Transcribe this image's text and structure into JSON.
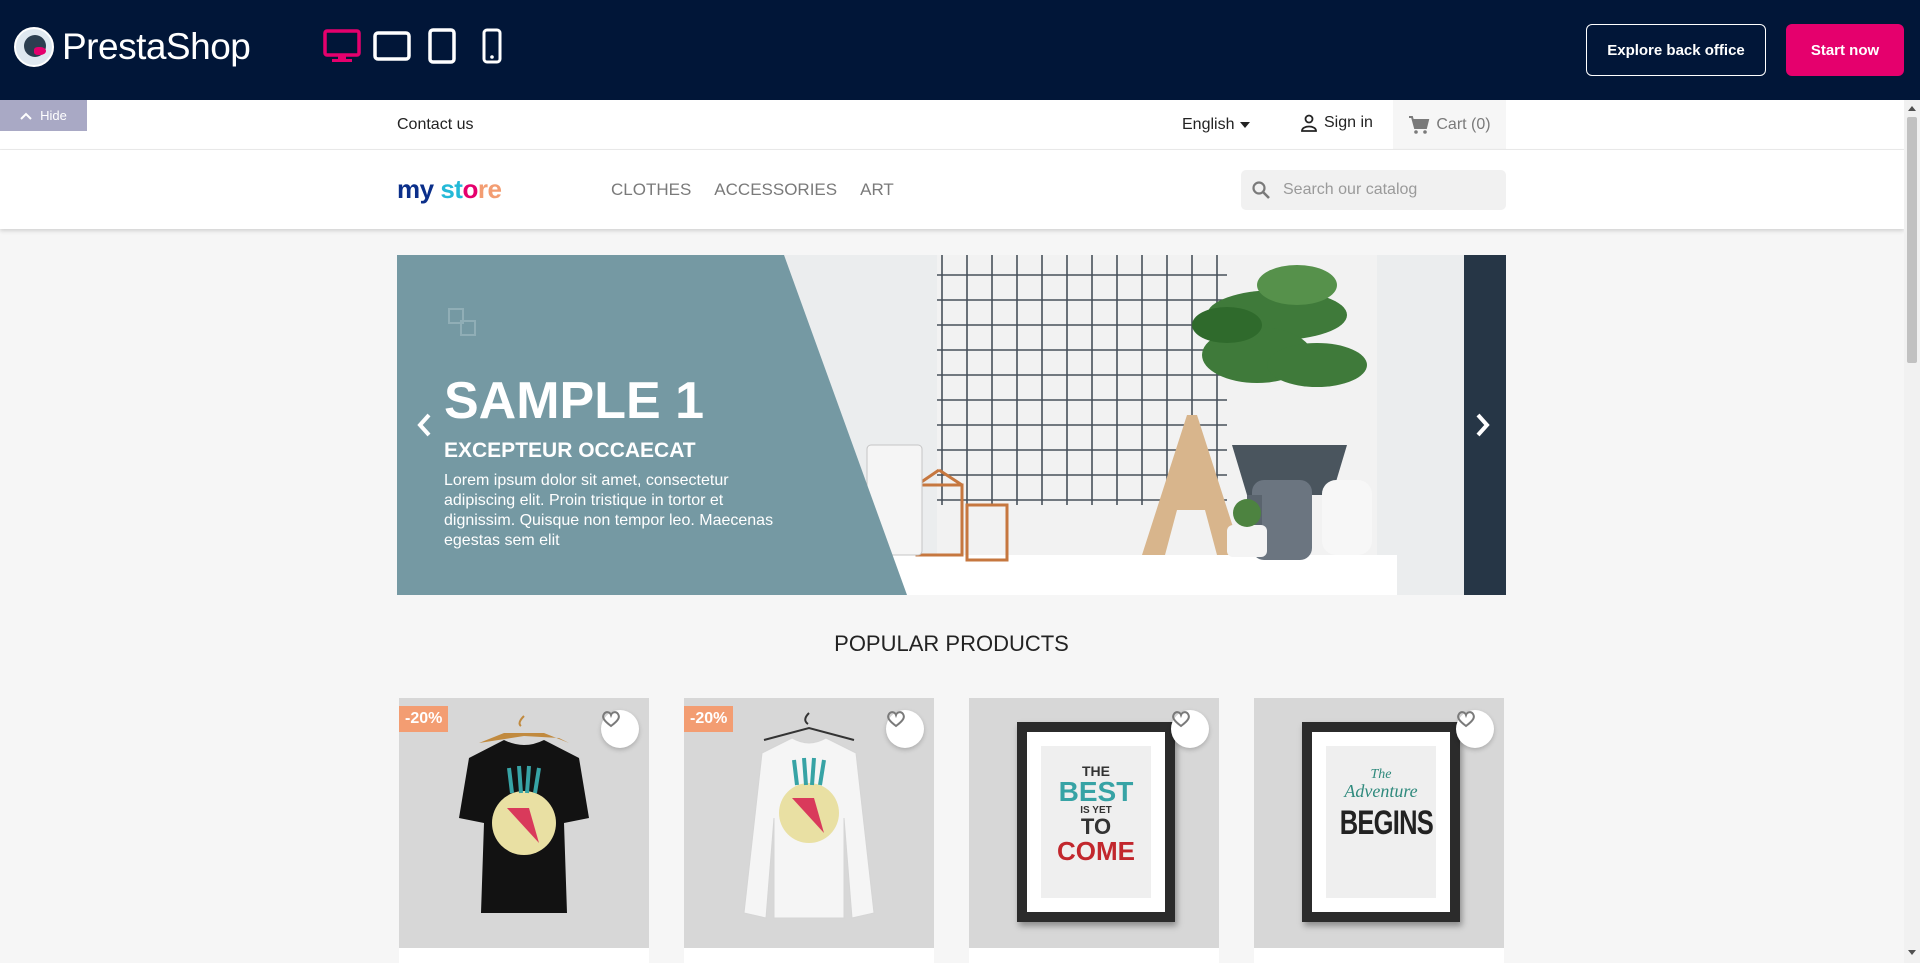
{
  "demo_bar": {
    "brand": "PrestaShop",
    "devices": [
      "desktop-icon",
      "tablet-landscape-icon",
      "tablet-portrait-icon",
      "mobile-icon"
    ],
    "explore_label": "Explore back office",
    "start_label": "Start now",
    "hide_label": "Hide",
    "colors": {
      "bar": "#011638",
      "accent": "#e5006d"
    }
  },
  "header": {
    "contact": "Contact us",
    "language": "English",
    "signin": "Sign in",
    "cart": "Cart (0)",
    "logo": {
      "part1": "my",
      "part2": "st",
      "part3": "o",
      "part4": "re"
    },
    "menu": [
      "CLOTHES",
      "ACCESSORIES",
      "ART"
    ],
    "search_placeholder": "Search our catalog"
  },
  "carousel": {
    "title": "SAMPLE 1",
    "subtitle": "EXCEPTEUR OCCAECAT",
    "description": "Lorem ipsum dolor sit amet, consectetur adipiscing elit. Proin tristique in tortor et dignissim. Quisque non tempor leo. Maecenas egestas sem elit"
  },
  "popular": {
    "title": "POPULAR PRODUCTS",
    "products": [
      {
        "discount": "-20%",
        "image": "black-tshirt-hummingbird"
      },
      {
        "discount": "-20%",
        "image": "white-sweater-hummingbird"
      },
      {
        "discount": "",
        "image": "poster-the-best-is-yet-to-come",
        "poster_lines": [
          "THE",
          "BEST",
          "IS YET",
          "TO",
          "COME"
        ]
      },
      {
        "discount": "",
        "image": "poster-the-adventure-begins",
        "poster_lines": [
          "The",
          "Adventure",
          "BEGINS"
        ]
      }
    ]
  }
}
